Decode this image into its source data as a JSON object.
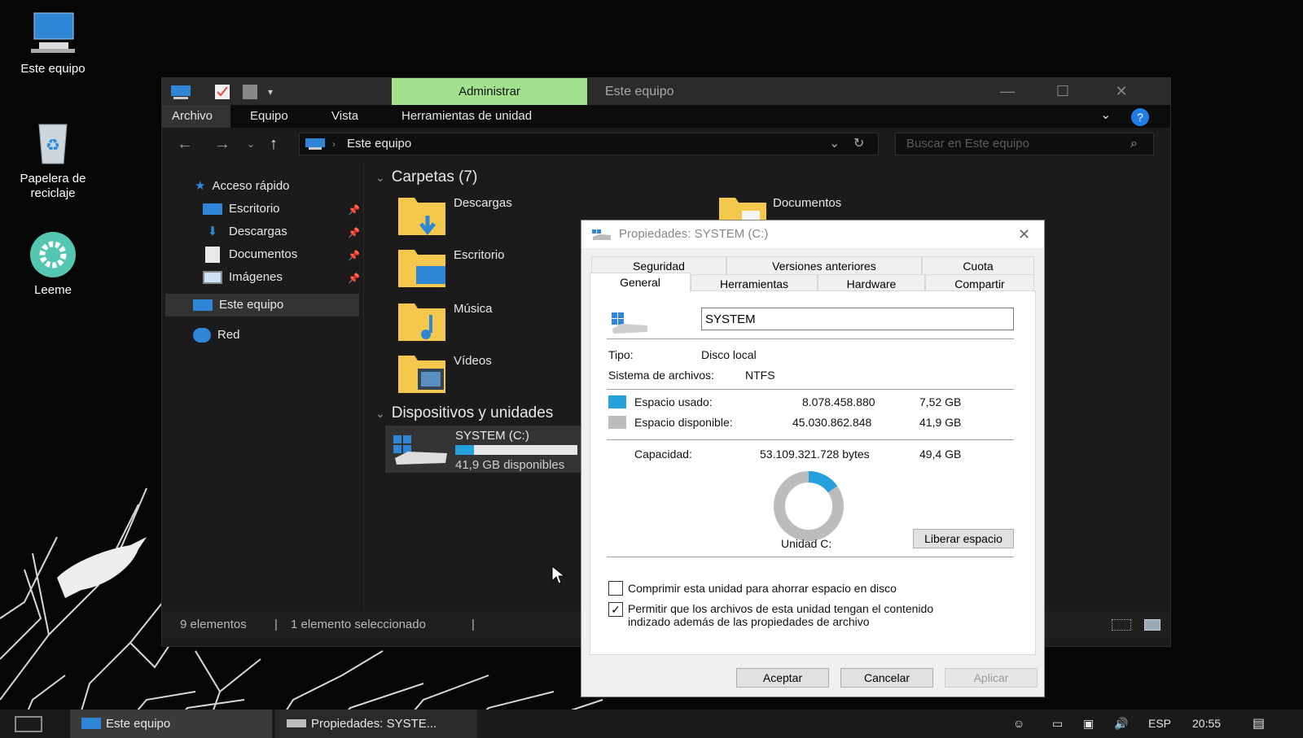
{
  "desktop": {
    "icons": [
      {
        "label": "Este equipo"
      },
      {
        "label_line1": "Papelera de",
        "label_line2": "reciclaje"
      },
      {
        "label": "Leeme"
      }
    ]
  },
  "explorer": {
    "context_tab": "Administrar",
    "title": "Este equipo",
    "ribbon_tabs": [
      "Archivo",
      "Equipo",
      "Vista",
      "Herramientas de unidad"
    ],
    "address": "Este equipo",
    "search_placeholder": "Buscar en Este equipo",
    "nav": {
      "quick_access": "Acceso rápido",
      "quick_items": [
        "Escritorio",
        "Descargas",
        "Documentos",
        "Imágenes"
      ],
      "this_pc": "Este equipo",
      "network": "Red"
    },
    "folders_header": "Carpetas (7)",
    "folders": [
      "Descargas",
      "Documentos",
      "Escritorio",
      "Música",
      "Vídeos"
    ],
    "devices_header": "Dispositivos y unidades",
    "drive": {
      "name": "SYSTEM (C:)",
      "free": "41,9 GB disponibles",
      "used_fraction": 0.15
    },
    "status": {
      "items": "9 elementos",
      "selected": "1 elemento seleccionado"
    }
  },
  "dialog": {
    "title": "Propiedades: SYSTEM (C:)",
    "tabs_row1": [
      "Seguridad",
      "Versiones anteriores",
      "Cuota"
    ],
    "tabs_row2": [
      "General",
      "Herramientas",
      "Hardware",
      "Compartir"
    ],
    "volume_name": "SYSTEM",
    "type_label": "Tipo:",
    "type_value": "Disco local",
    "fs_label": "Sistema de archivos:",
    "fs_value": "NTFS",
    "used_label": "Espacio usado:",
    "used_bytes": "8.078.458.880",
    "used_gb": "7,52 GB",
    "free_label": "Espacio disponible:",
    "free_bytes": "45.030.862.848",
    "free_gb": "41,9 GB",
    "capacity_label": "Capacidad:",
    "capacity_bytes": "53.109.321.728 bytes",
    "capacity_gb": "49,4 GB",
    "used_fraction": 0.152,
    "drive_label": "Unidad C:",
    "free_space_button": "Liberar espacio",
    "compress_label": "Comprimir esta unidad para ahorrar espacio en disco",
    "index_label_line1": "Permitir que los archivos de esta unidad tengan el contenido",
    "index_label_line2": "indizado además de las propiedades de archivo",
    "compress_checked": false,
    "index_checked": true,
    "ok": "Aceptar",
    "cancel": "Cancelar",
    "apply": "Aplicar",
    "colors": {
      "used": "#26a0da",
      "free": "#bcbcbc"
    }
  },
  "taskbar": {
    "tasks": [
      "Este equipo",
      "Propiedades: SYSTE..."
    ],
    "lang": "ESP",
    "time": "20:55"
  }
}
